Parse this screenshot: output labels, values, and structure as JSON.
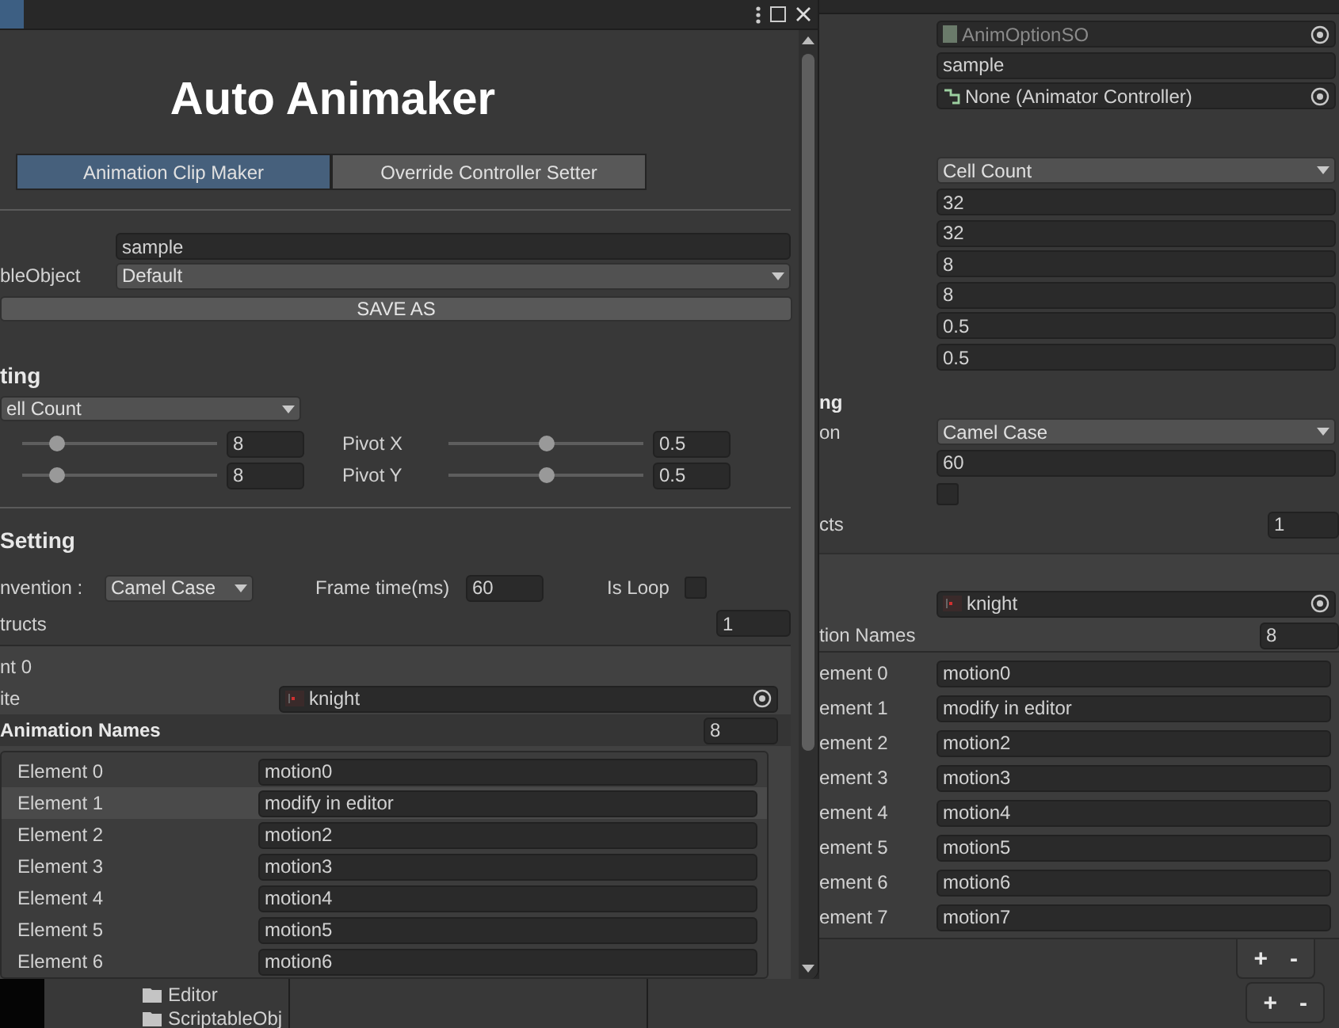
{
  "window": {
    "title": "Auto Animaker",
    "tabs": [
      {
        "label": "Animation Clip Maker",
        "selected": true
      },
      {
        "label": "Override Controller Setter",
        "selected": false
      }
    ],
    "name_field": {
      "value": "sample"
    },
    "preset": {
      "label": "bleObject",
      "value": "Default"
    },
    "save_button": "SAVE AS",
    "sprite_setting": {
      "header": "ting",
      "mode": "ell Count",
      "slider_rows": [
        {
          "left": {
            "level": 0.18,
            "value": "8"
          },
          "right": {
            "label": "Pivot X",
            "level": 0.5,
            "value": "0.5"
          }
        },
        {
          "left": {
            "level": 0.18,
            "value": "8"
          },
          "right": {
            "label": "Pivot Y",
            "level": 0.5,
            "value": "0.5"
          }
        }
      ]
    },
    "animation_setting": {
      "header": "Setting",
      "convention_label": "nvention :",
      "convention": "Camel Case",
      "frame_time_label": "Frame time(ms)",
      "frame_time": "60",
      "loop_label": "Is Loop",
      "loop_checked": false,
      "structs_label": "tructs",
      "structs_count": "1",
      "element": {
        "header": "nt 0",
        "sprite_label": "ite",
        "sprite": "knight",
        "names_label": "Animation Names",
        "names_count": "8",
        "names": [
          {
            "label": "Element 0",
            "value": "motion0",
            "selected": false
          },
          {
            "label": "Element 1",
            "value": "modify in editor",
            "selected": true
          },
          {
            "label": "Element 2",
            "value": "motion2",
            "selected": false
          },
          {
            "label": "Element 3",
            "value": "motion3",
            "selected": false
          },
          {
            "label": "Element 4",
            "value": "motion4",
            "selected": false
          },
          {
            "label": "Element 5",
            "value": "motion5",
            "selected": false
          },
          {
            "label": "Element 6",
            "value": "motion6",
            "selected": false
          }
        ]
      }
    }
  },
  "inspector": {
    "script": "AnimOptionSO",
    "name": "sample",
    "controller": "None (Animator Controller)",
    "mode": "Cell Count",
    "values": [
      "32",
      "32",
      "8",
      "8",
      "0.5",
      "0.5"
    ],
    "header": "ng",
    "convention_label": "on",
    "convention": "Camel Case",
    "frame_time": "60",
    "loop_checked": false,
    "structs_label": "cts",
    "structs_count": "1",
    "sprite": "knight",
    "names_label": "tion Names",
    "names_count": "8",
    "names": [
      {
        "label": "ement 0",
        "value": "motion0"
      },
      {
        "label": "ement 1",
        "value": "modify in editor"
      },
      {
        "label": "ement 2",
        "value": "motion2"
      },
      {
        "label": "ement 3",
        "value": "motion3"
      },
      {
        "label": "ement 4",
        "value": "motion4"
      },
      {
        "label": "ement 5",
        "value": "motion5"
      },
      {
        "label": "ement 6",
        "value": "motion6"
      },
      {
        "label": "ement 7",
        "value": "motion7"
      }
    ],
    "list_buttons": [
      "+",
      "-"
    ],
    "outer_list_buttons": [
      "+",
      "-"
    ]
  },
  "project": {
    "folders": [
      "Editor",
      "ScriptableObj"
    ]
  }
}
